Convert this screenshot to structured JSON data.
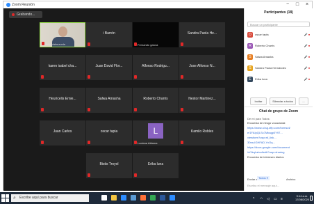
{
  "window": {
    "title": "Zoom Reunión",
    "controls": {
      "minimize": "−",
      "maximize": "□",
      "close": "×"
    }
  },
  "recording": {
    "label": "Grabando..."
  },
  "gallery": {
    "tiles": [
      {
        "name": "Julio Valenzuela",
        "type": "video",
        "foot": true
      },
      {
        "name": "i Barrón",
        "type": "plain"
      },
      {
        "name": "Fernando garcía",
        "type": "black",
        "foot": true
      },
      {
        "name": "Sandra Paola He...",
        "type": "plain"
      },
      {
        "name": "karen isabel cha...",
        "type": "plain"
      },
      {
        "name": "Juan David Flor...",
        "type": "plain"
      },
      {
        "name": "Alfonso Rodrigu...",
        "type": "plain"
      },
      {
        "name": "Jose Alfonso N...",
        "type": "plain"
      },
      {
        "name": "Heuricelis Ernie...",
        "type": "plain"
      },
      {
        "name": "Salwa Amasha",
        "type": "plain"
      },
      {
        "name": "Roberto Charris",
        "type": "plain"
      },
      {
        "name": "Nestor Martinez...",
        "type": "plain"
      },
      {
        "name": "Juan Carlos",
        "type": "plain"
      },
      {
        "name": "oscar tapia",
        "type": "plain"
      },
      {
        "name": "Luciana Aldama",
        "type": "initial",
        "initial": "L",
        "foot": true
      },
      {
        "name": "Kamilo Robles",
        "type": "plain"
      },
      {
        "name": "Bistis Troyol",
        "type": "plain"
      },
      {
        "name": "Erika luna",
        "type": "plain"
      }
    ]
  },
  "participants": {
    "title": "Participantes (18)",
    "search_placeholder": "Buscar un participante",
    "list": [
      {
        "name": "oscar tapia",
        "avatar_color": "#d84a3b",
        "initial": "O"
      },
      {
        "name": "Roberto Charris",
        "avatar_color": "#9b59b6",
        "initial": "R"
      },
      {
        "name": "Salwa Amasha",
        "avatar_color": "#e67e22",
        "initial": "S"
      },
      {
        "name": "Sandra Paola Hernández",
        "avatar_color": "#e6a41f",
        "initial": "S"
      },
      {
        "name": "Erika luna",
        "avatar_color": "#34495e",
        "initial": "E"
      }
    ],
    "status_icons": "🎤 ⏹",
    "buttons": {
      "invite": "Invitar",
      "mute_all": "Silenciar a todos",
      "more": "..."
    }
  },
  "chat": {
    "title": "Chat de grupo de Zoom",
    "sender": "De mí para Todos:",
    "lines": [
      {
        "text": "Encuesta de riesgo vocacional:",
        "link": false
      },
      {
        "text": "https://www.ul.sg.sftp.com/forms/d/",
        "link": true
      },
      {
        "text": "e/1FAIpQLSc7Mkagp0Y97...",
        "link": true
      },
      {
        "text": "viewform?usp=sf_link...",
        "link": true
      },
      {
        "text": "30ea-IGHFAD-YxOq...",
        "link": true
      },
      {
        "text": "https://docs.google.com/document",
        "link": true
      },
      {
        "text": "/d/1kqLabcd/edit?usp=sharing",
        "link": true
      },
      {
        "text": "Encuesta de intereses diarios",
        "link": false
      }
    ],
    "to_label": "Enviar a:",
    "to_value": "Todos ▾",
    "file_label": "Archivo",
    "input_placeholder": "Escriba el mensaje aquí..."
  },
  "taskbar": {
    "search_text": "Escribe aquí para buscar",
    "apps": [
      {
        "name": "task-view-icon",
        "color": "#ffffff"
      },
      {
        "name": "file-explorer-icon",
        "color": "#f4c542"
      },
      {
        "name": "mail-icon",
        "color": "#2d8cff"
      },
      {
        "name": "store-icon",
        "color": "#5b9bd5"
      },
      {
        "name": "firefox-icon",
        "color": "#ff7139"
      },
      {
        "name": "chrome-icon",
        "color": "#34a853"
      },
      {
        "name": "word-icon",
        "color": "#2b579a"
      },
      {
        "name": "zoom-icon",
        "color": "#2d8cff"
      }
    ],
    "time": "9:14 a.m.",
    "date": "17/08/2020"
  },
  "colors": {
    "active_speaker": "#9be54b",
    "muted": "#e02828",
    "accent": "#2d8cff"
  }
}
